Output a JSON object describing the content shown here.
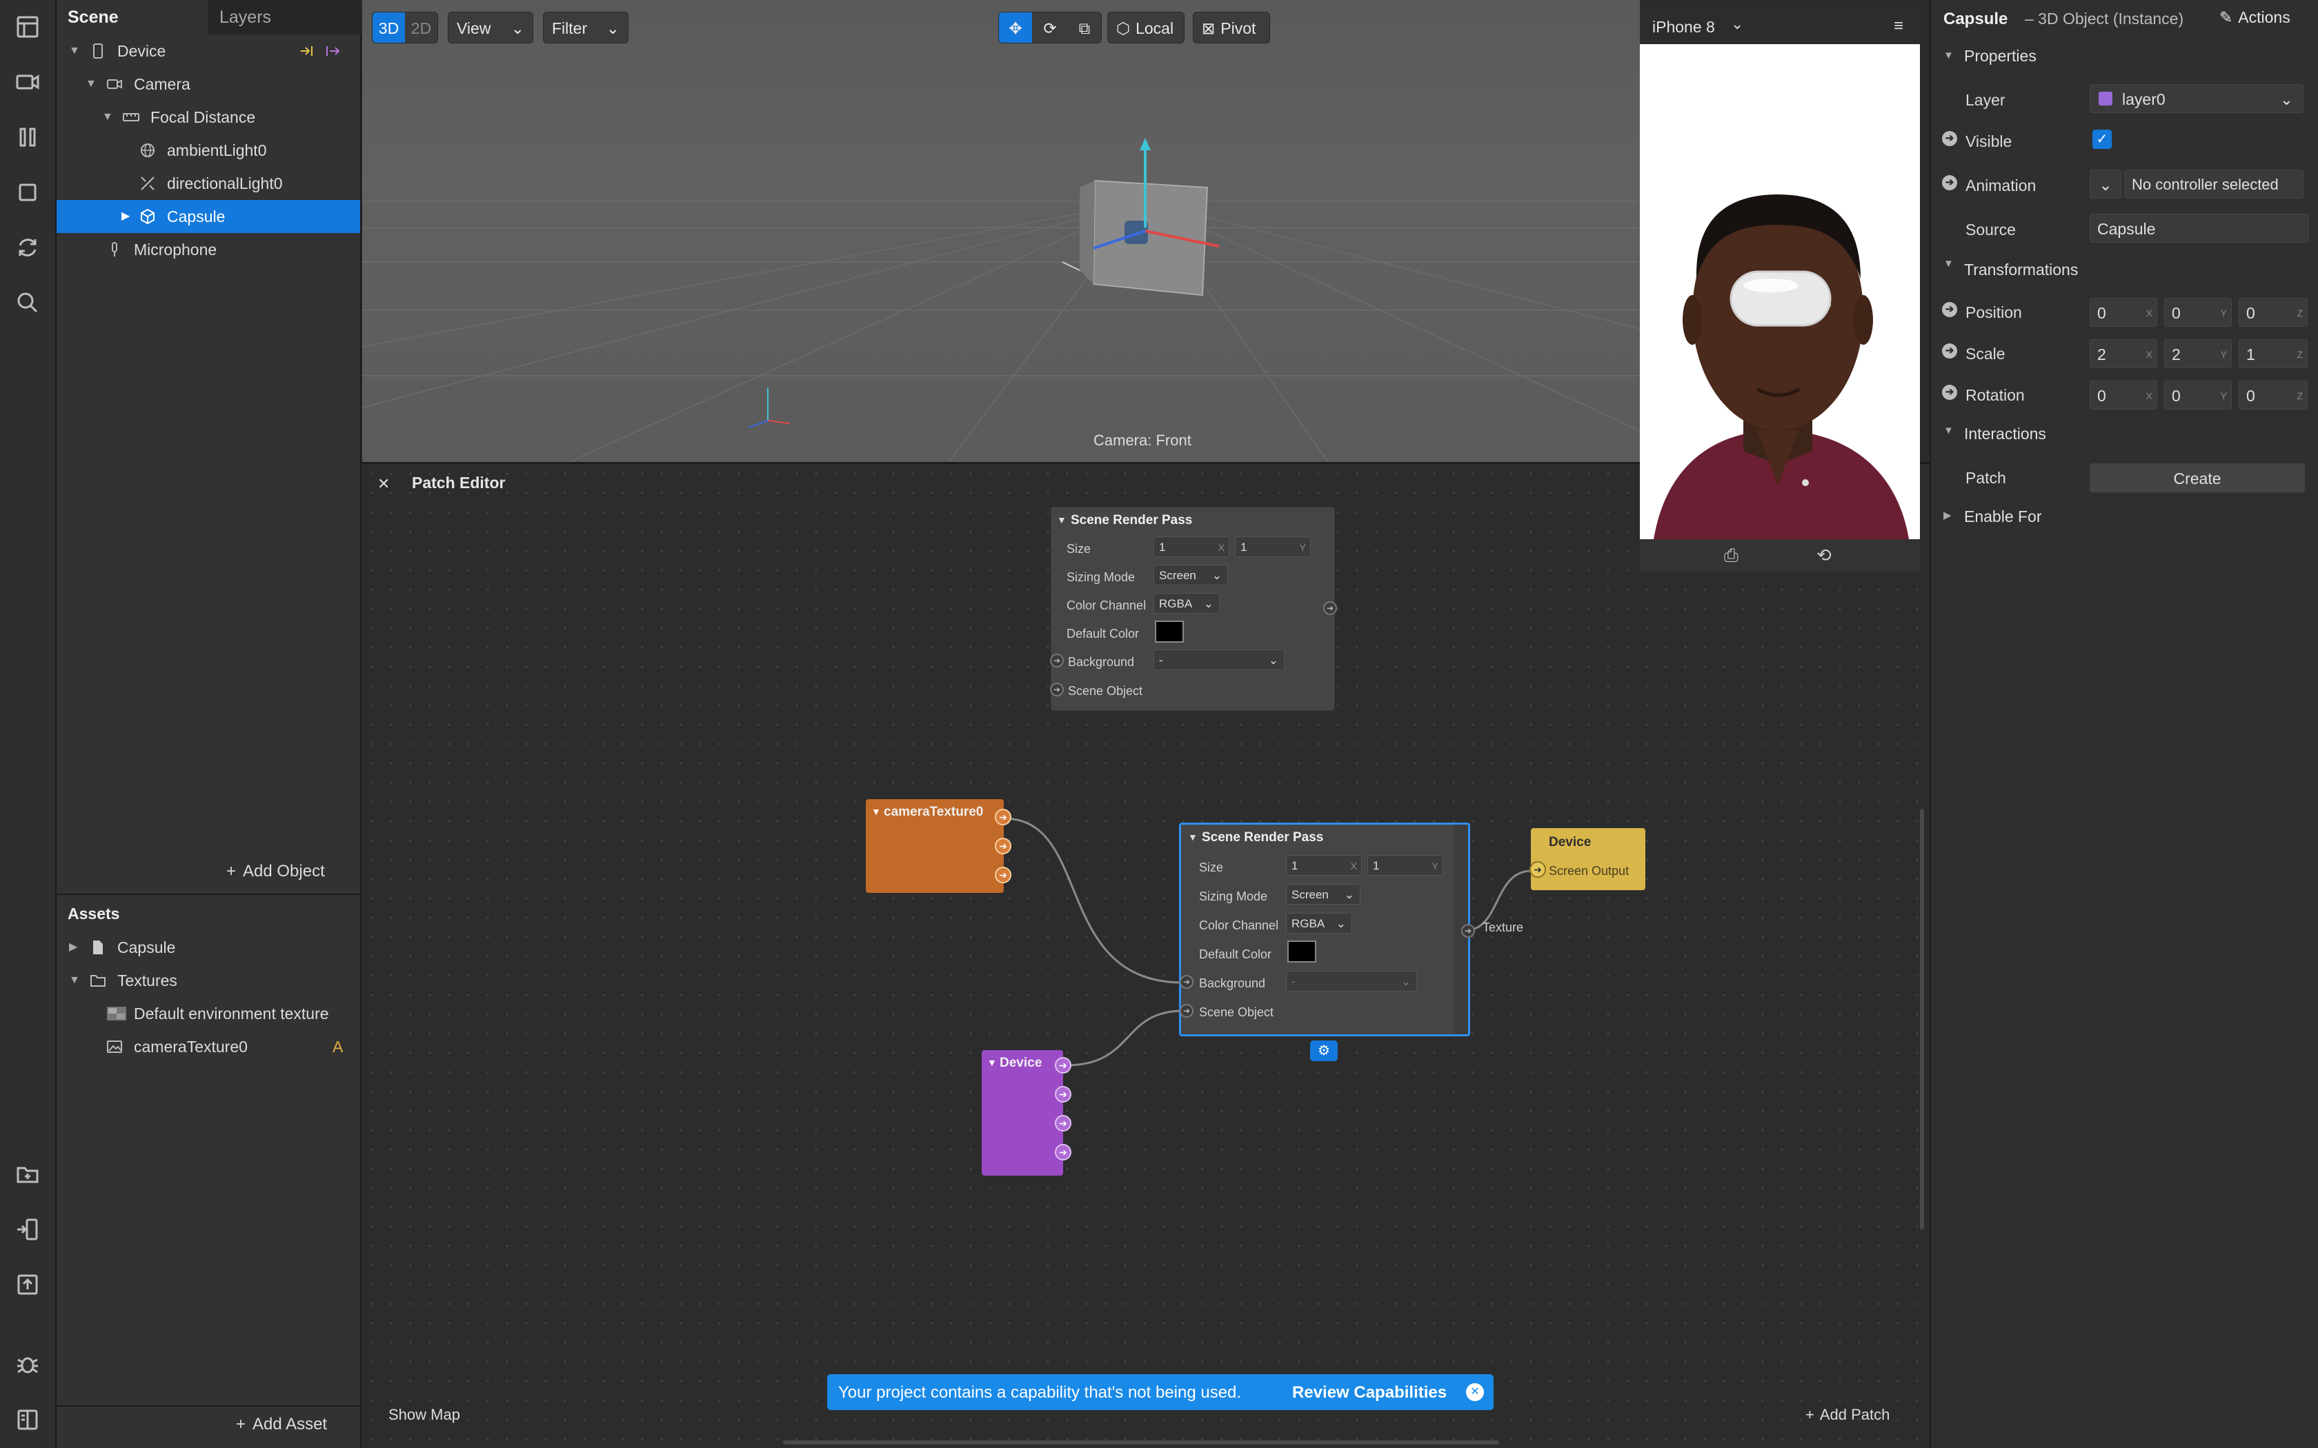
{
  "left_panel": {
    "tabs": [
      "Scene",
      "Layers"
    ],
    "scene_tree": [
      {
        "label": "Device",
        "icon": "phone-icon"
      },
      {
        "label": "Camera",
        "icon": "camera-icon"
      },
      {
        "label": "Focal Distance",
        "icon": "focal-icon"
      },
      {
        "label": "ambientLight0",
        "icon": "globe-icon"
      },
      {
        "label": "directionalLight0",
        "icon": "light-icon"
      },
      {
        "label": "Capsule",
        "icon": "cube-icon",
        "selected": true
      },
      {
        "label": "Microphone",
        "icon": "microphone-icon"
      }
    ],
    "add_object": "Add Object",
    "assets_title": "Assets",
    "assets": [
      {
        "label": "Capsule",
        "icon": "file-icon"
      },
      {
        "label": "Textures",
        "icon": "folder-icon"
      },
      {
        "label": "Default environment texture",
        "icon": "texture-icon"
      },
      {
        "label": "cameraTexture0",
        "icon": "image-icon",
        "badge": "A"
      }
    ],
    "add_asset": "Add Asset"
  },
  "viewport": {
    "mode_3d": "3D",
    "mode_2d": "2D",
    "view_label": "View",
    "filter_label": "Filter",
    "local_label": "Local",
    "pivot_label": "Pivot",
    "camera_label": "Camera: Front"
  },
  "simulator": {
    "device": "iPhone 8"
  },
  "inspector": {
    "object_name": "Capsule",
    "object_type": "– 3D Object (Instance)",
    "actions": "Actions",
    "properties_title": "Properties",
    "layer_label": "Layer",
    "layer_value": "layer0",
    "visible_label": "Visible",
    "animation_label": "Animation",
    "animation_value": "No controller selected",
    "source_label": "Source",
    "source_value": "Capsule",
    "transformations_title": "Transformations",
    "position_label": "Position",
    "position": [
      "0",
      "0",
      "0"
    ],
    "scale_label": "Scale",
    "scale": [
      "2",
      "2",
      "1"
    ],
    "rotation_label": "Rotation",
    "rotation": [
      "0",
      "0",
      "0"
    ],
    "axes": [
      "X",
      "Y",
      "Z"
    ],
    "interactions_title": "Interactions",
    "patch_label": "Patch",
    "create_label": "Create",
    "enable_for": "Enable For",
    "accent": "#1479dc"
  },
  "patch_editor": {
    "title": "Patch Editor",
    "show_map": "Show Map",
    "add_patch": "Add Patch",
    "banner_text": "Your project contains a capability that's not being used.",
    "banner_link": "Review Capabilities",
    "render_pass_top": {
      "title": "Scene Render Pass",
      "size_label": "Size",
      "size": [
        "1",
        "1"
      ],
      "sizing_label": "Sizing Mode",
      "sizing": "Screen",
      "channel_label": "Color Channel",
      "channel": "RGBA",
      "default_color_label": "Default Color",
      "background_label": "Background",
      "background": "-",
      "scene_object_label": "Scene Object"
    },
    "render_pass_main": {
      "title": "Scene Render Pass",
      "size_label": "Size",
      "size": [
        "1",
        "1"
      ],
      "sizing_label": "Sizing Mode",
      "sizing": "Screen",
      "channel_label": "Color Channel",
      "channel": "RGBA",
      "default_color_label": "Default Color",
      "background_label": "Background",
      "background": "-",
      "scene_object_label": "Scene Object",
      "output_label": "Texture"
    },
    "camera_texture_node": "cameraTexture0",
    "device_node": "Device",
    "device_output_title": "Device",
    "device_output_port": "Screen Output",
    "colors": {
      "camera_node": "#c26a28",
      "device_node": "#9c4bc6",
      "device_output": "#d8b64a"
    }
  }
}
